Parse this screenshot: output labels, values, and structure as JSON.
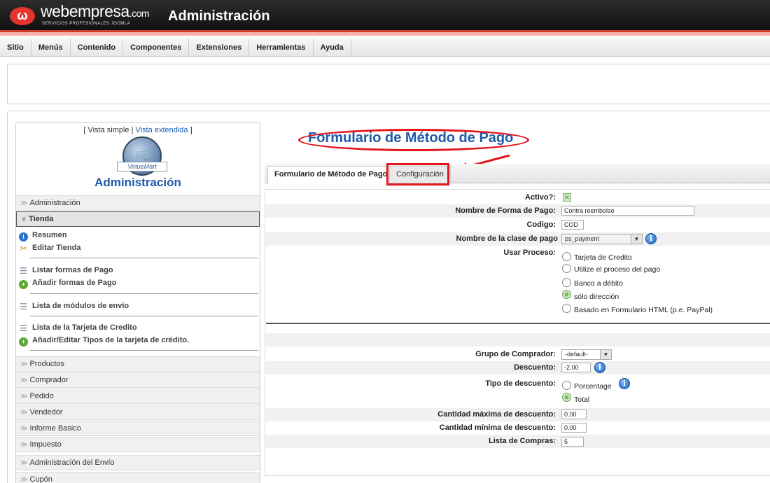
{
  "header": {
    "logo_mark": "ω",
    "brand": "webempresa",
    "brand_tld": ".com",
    "brand_sub": "SERVICIOS PROFESIONALES JOOMLA",
    "app_title": "Administración"
  },
  "menubar": [
    "Sitio",
    "Menús",
    "Contenido",
    "Componentes",
    "Extensiones",
    "Herramientas",
    "Ayuda"
  ],
  "sidebar": {
    "view_simple": "[ Vista simple |",
    "view_extended": "Vista extendida",
    "view_close": "]",
    "logo_label": "VirtueMart",
    "title": "Administración",
    "sections_top": [
      "Administración",
      "Tienda"
    ],
    "tienda_items": [
      "Resumen",
      "Editar Tienda",
      "Listar formas de Pago",
      "Añadir formas de Pago",
      "Lista de módulos de envío",
      "Lista de la Tarjeta de Credito",
      "Añadir/Editar Tipos de la tarjeta de crédito."
    ],
    "sections_bottom": [
      "Productos",
      "Comprador",
      "Pedido",
      "Vendedor",
      "Informe Basico",
      "Impuesto",
      "Administración del Envío",
      "Cupón"
    ]
  },
  "content": {
    "title": "Formulario de Método de Pago",
    "tabs": [
      "Formulario de Método de Pago",
      "Configuración"
    ],
    "fields": {
      "activo_label": "Activo?:",
      "nombre_label": "Nombre de Forma de Pago:",
      "nombre_value": "Contra reembolso",
      "codigo_label": "Codigo:",
      "codigo_value": "COD",
      "clase_label": "Nombre de la clase de pago",
      "clase_value": "ps_payment",
      "proceso_label": "Usar Proceso:",
      "proceso_options": [
        "Tarjeta de Credito",
        "Utilize el proceso del pago",
        "Banco a débito",
        "sólo dirección",
        "Basado en Formulario HTML (p.e. PayPal)"
      ],
      "proceso_selected": "sólo dirección",
      "grupo_label": "Grupo de Comprador:",
      "grupo_value": "-default-",
      "descuento_label": "Descuento:",
      "descuento_value": "-2.00",
      "tipo_label": "Tipo de descuento:",
      "tipo_options": [
        "Porcentage",
        "Total"
      ],
      "tipo_selected": "Total",
      "max_label": "Cantidad máxima de descuento:",
      "max_value": "0.00",
      "min_label": "Cantidad mínima de descuento:",
      "min_value": "0.00",
      "lista_label": "Lista de Compras:",
      "lista_value": "5"
    }
  },
  "colors": {
    "accent_blue": "#1e5aa8",
    "highlight_red": "#e3161d",
    "header_dark": "#1a1a1a"
  }
}
